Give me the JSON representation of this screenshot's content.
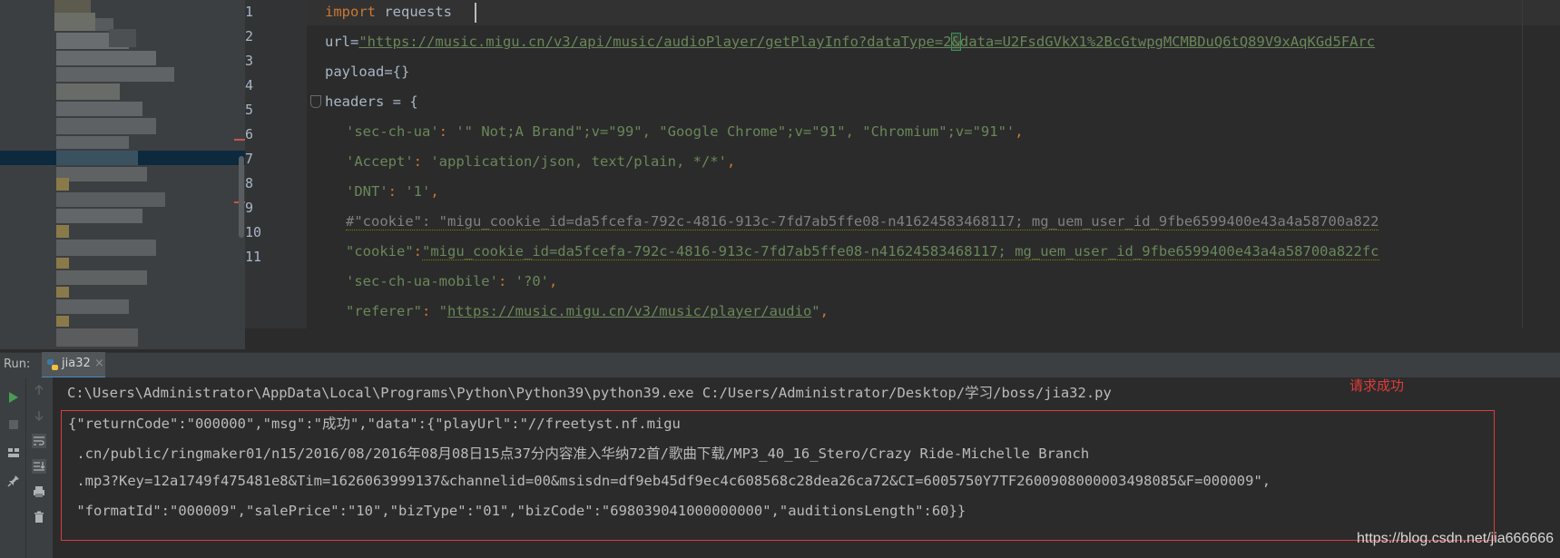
{
  "editor": {
    "line_numbers": [
      "1",
      "2",
      "3",
      "4",
      "5",
      "6",
      "7",
      "8",
      "9",
      "10",
      "11"
    ],
    "lines": {
      "l1": {
        "kw": "import",
        "rest": " requests"
      },
      "l2": {
        "pre": "url=",
        "str_a": "\"https://music.migu.cn/v3/api/music/audioPlayer/getPlayInfo?dataType=2",
        "str_b": "&",
        "str_c": "data=U2FsdGVkX1%2BcGtwpgMCMBDuQ6tQ89V9xAqKGd5FArc"
      },
      "l3": {
        "text": "payload={}"
      },
      "l4": {
        "text": "headers = {"
      },
      "l5": {
        "key": "'sec-ch-ua'",
        "colon": ": ",
        "val": "'\" Not;A Brand\";v=\"99\", \"Google Chrome\";v=\"91\", \"Chromium\";v=\"91\"'",
        "comma": ","
      },
      "l6": {
        "key": "'Accept'",
        "colon": ": ",
        "val": "'application/json, text/plain, */*'",
        "comma": ","
      },
      "l7": {
        "key": "'DNT'",
        "colon": ": ",
        "val": "'1'",
        "comma": ","
      },
      "l8": {
        "text": "#\"cookie\": \"migu_cookie_id=da5fcefa-792c-4816-913c-7fd7ab5ffe08-n41624583468117; mg_uem_user_id_9fbe6599400e43a4a58700a822"
      },
      "l9": {
        "key": "\"cookie\"",
        "colon": ":",
        "val": "\"migu_cookie_id=da5fcefa-792c-4816-913c-7fd7ab5ffe08-n41624583468117; mg_uem_user_id_9fbe6599400e43a4a58700a822fc"
      },
      "l10": {
        "key": "'sec-ch-ua-mobile'",
        "colon": ": ",
        "val": "'?0'",
        "comma": ","
      },
      "l11": {
        "key": "\"referer\"",
        "colon": ": ",
        "q1": "\"",
        "val": "https://music.migu.cn/v3/music/player/audio",
        "q2": "\"",
        "comma": ","
      }
    }
  },
  "run": {
    "label": "Run:",
    "tab": "jia32",
    "tab_close": "×",
    "command": "C:\\Users\\Administrator\\AppData\\Local\\Programs\\Python\\Python39\\python39.exe C:/Users/Administrator/Desktop/学习/boss/jia32.py",
    "output": [
      "{\"returnCode\":\"000000\",\"msg\":\"成功\",\"data\":{\"playUrl\":\"//freetyst.nf.migu",
      " .cn/public/ringmaker01/n15/2016/08/2016年08月08日15点37分内容准入华纳72首/歌曲下载/MP3_40_16_Stero/Crazy Ride-Michelle Branch",
      " .mp3?Key=12a1749f475481e8&Tim=1626063999137&channelid=00&msisdn=df9eb45df9ec4c608568c28dea26ca72&CI=6005750Y7TF2600908000003498085&F=000009\",",
      " \"formatId\":\"000009\",\"salePrice\":\"10\",\"bizType\":\"01\",\"bizCode\":\"698039041000000000\",\"auditionsLength\":60}}"
    ],
    "annotation": "请求成功"
  },
  "watermark": "https://blog.csdn.net/jia666666",
  "colors": {
    "keyword": "#cc7832",
    "string": "#6a8759",
    "annotation": "#e03b3b",
    "run_green": "#499c54"
  }
}
